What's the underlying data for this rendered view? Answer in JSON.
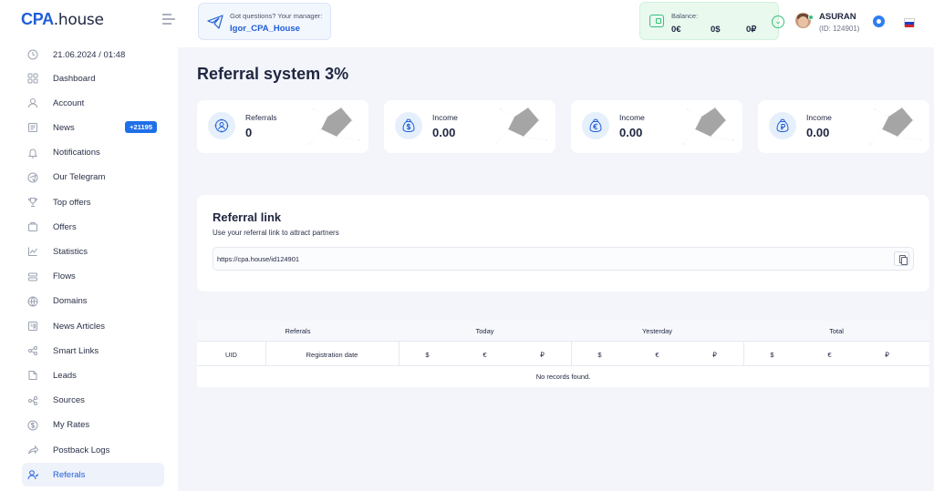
{
  "logo": {
    "part1": "CPA",
    "part2": ".house"
  },
  "sidebar": {
    "datetime": "21.06.2024 / 01:48",
    "items": [
      {
        "label": "Dashboard",
        "icon": "grid-icon"
      },
      {
        "label": "Account",
        "icon": "user-icon"
      },
      {
        "label": "News",
        "icon": "news-icon",
        "badge": "+21195"
      },
      {
        "label": "Notifications",
        "icon": "bell-icon"
      },
      {
        "label": "Our Telegram",
        "icon": "telegram-icon"
      },
      {
        "label": "Top offers",
        "icon": "trophy-icon"
      },
      {
        "label": "Offers",
        "icon": "briefcase-icon"
      },
      {
        "label": "Statistics",
        "icon": "chart-icon"
      },
      {
        "label": "Flows",
        "icon": "flows-icon"
      },
      {
        "label": "Domains",
        "icon": "globe-icon"
      },
      {
        "label": "News Articles",
        "icon": "article-icon"
      },
      {
        "label": "Smart Links",
        "icon": "share-icon"
      },
      {
        "label": "Leads",
        "icon": "leads-icon"
      },
      {
        "label": "Sources",
        "icon": "sources-icon"
      },
      {
        "label": "My Rates",
        "icon": "dollar-circle-icon"
      },
      {
        "label": "Postback Logs",
        "icon": "forward-icon"
      },
      {
        "label": "Referals",
        "icon": "referals-icon",
        "active": true
      }
    ]
  },
  "header": {
    "manager_question": "Got questions? Your manager:",
    "manager_name": "Igor_CPA_House",
    "balance_label": "Balance:",
    "balance_eur": "0€",
    "balance_usd": "0$",
    "balance_rub": "0₽",
    "user_name": "ASURAN",
    "user_id": "(ID: 124901)"
  },
  "main": {
    "title": "Referral system 3%",
    "stats": [
      {
        "label": "Referrals",
        "value": "0",
        "icon": "referrals-icon"
      },
      {
        "label": "Income",
        "value": "0.00",
        "icon": "money-bag-dollar-icon"
      },
      {
        "label": "Income",
        "value": "0.00",
        "icon": "money-bag-euro-icon"
      },
      {
        "label": "Income",
        "value": "0.00",
        "icon": "money-bag-ruble-icon"
      }
    ],
    "referral": {
      "title": "Referral link",
      "subtitle": "Use your referral link to attract partners",
      "url": "https://cpa.house/id124901"
    },
    "table": {
      "group_headers": [
        "Referals",
        "Today",
        "Yesterday",
        "Total"
      ],
      "columns": [
        "UID",
        "Registration date",
        "$",
        "€",
        "₽",
        "$",
        "€",
        "₽",
        "$",
        "€",
        "₽"
      ],
      "empty_text": "No records found."
    }
  },
  "colors": {
    "accent": "#1f5fd6",
    "balance_green": "#33c27a",
    "badge_blue": "#1f6fe8"
  }
}
